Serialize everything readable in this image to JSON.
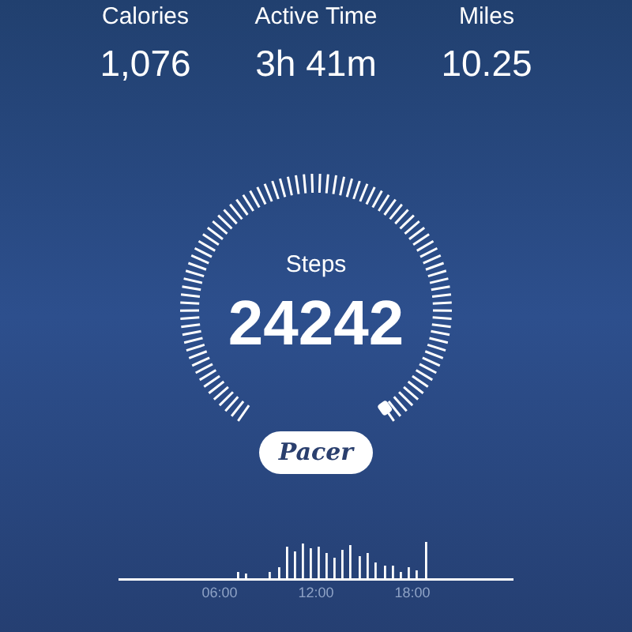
{
  "stats": [
    {
      "label": "Calories",
      "value": "1,076"
    },
    {
      "label": "Active Time",
      "value": "3h 41m"
    },
    {
      "label": "Miles",
      "value": "10.25"
    }
  ],
  "gauge": {
    "label": "Steps",
    "value": "24242"
  },
  "brand_button": {
    "label": "Pacer"
  },
  "timeline": {
    "tick_labels": [
      "06:00",
      "12:00",
      "18:00"
    ]
  }
}
